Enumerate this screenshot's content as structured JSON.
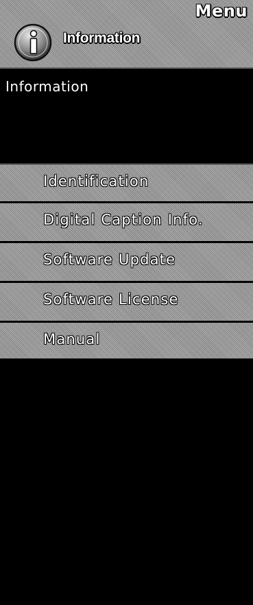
{
  "header": {
    "menu_label": "Menu",
    "title": "Information",
    "icon": "info-icon"
  },
  "section": {
    "label": "Information"
  },
  "menu": {
    "items": [
      {
        "label": "Identification"
      },
      {
        "label": "Digital Caption Info."
      },
      {
        "label": "Software Update"
      },
      {
        "label": "Software License"
      },
      {
        "label": "Manual"
      }
    ]
  },
  "colors": {
    "background": "#000000",
    "panel": "#a8a8a8",
    "text": "#ffffff"
  }
}
